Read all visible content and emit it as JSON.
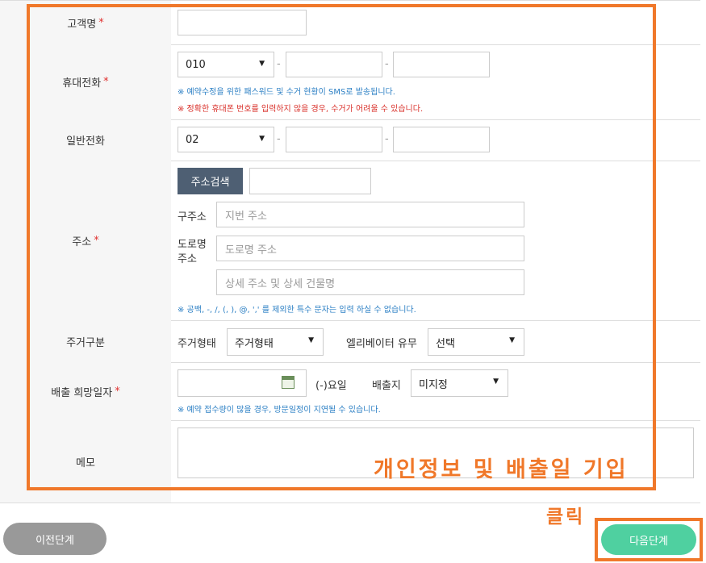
{
  "fields": {
    "customer_name": {
      "label": "고객명",
      "required": "*",
      "value": ""
    },
    "mobile": {
      "label": "휴대전화",
      "required": "*",
      "prefix": "010",
      "mid": "",
      "last": "",
      "dash": "-",
      "note1": "※ 예약수정을 위한 패스워드 및 수거 현황이 SMS로 발송됩니다.",
      "note2": "※ 정확한 휴대폰 번호를 입력하지 않을 경우, 수거가 어려울 수 있습니다."
    },
    "phone": {
      "label": "일반전화",
      "prefix": "02",
      "mid": "",
      "last": "",
      "dash": "-"
    },
    "address": {
      "label": "주소",
      "required": "*",
      "search_button": "주소검색",
      "old_label": "구주소",
      "old_placeholder": "지번 주소",
      "road_label_1": "도로명",
      "road_label_2": "주소",
      "road_placeholder": "도로명 주소",
      "detail_placeholder": "상세 주소 및 상세 건물명",
      "note": "※ 공백, -, /, (, ), @, ',' 를 제외한 특수 문자는 입력 하실 수 없습니다."
    },
    "residence": {
      "label": "주거구분",
      "type_label": "주거형태",
      "type_value": "주거형태",
      "elevator_label": "엘리베이터 유무",
      "elevator_value": "선택"
    },
    "discharge_date": {
      "label": "배출 희망일자",
      "required": "*",
      "weekday": "(-)요일",
      "place_label": "배출지",
      "place_value": "미지정",
      "note": "※ 예약 접수량이 많을 경우, 방문일정이 지연될 수 있습니다."
    },
    "memo": {
      "label": "메모"
    }
  },
  "annotations": {
    "form_note": "개인정보 및 배출일 기입",
    "click_note": "클릭"
  },
  "buttons": {
    "prev": "이전단계",
    "next": "다음단계"
  },
  "colors": {
    "highlight": "#f0782a",
    "required": "#e0302f",
    "note_blue": "#2b7fc4",
    "note_red": "#d9302a",
    "search_button": "#4e5f73",
    "next_button": "#4fd0a0",
    "prev_button": "#999999"
  }
}
